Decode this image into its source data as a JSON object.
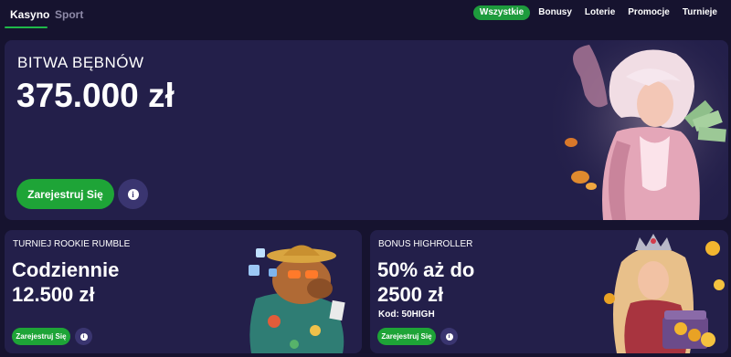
{
  "nav": {
    "tabs": [
      {
        "label": "Kasyno",
        "active": true
      },
      {
        "label": "Sport",
        "active": false
      }
    ],
    "filters": [
      {
        "label": "Wszystkie",
        "active": true
      },
      {
        "label": "Bonusy",
        "active": false
      },
      {
        "label": "Loterie",
        "active": false
      },
      {
        "label": "Promocje",
        "active": false
      },
      {
        "label": "Turnieje",
        "active": false
      }
    ]
  },
  "hero": {
    "eyebrow": "BITWA BĘBNÓW",
    "amount": "375.000 zł",
    "cta_label": "Zarejestruj Się",
    "info_icon": "info-icon",
    "art": "elf-prince-character-illustration"
  },
  "cards": [
    {
      "eyebrow": "TURNIEJ ROOKIE RUMBLE",
      "title_line1": "Codziennie",
      "title_line2": "12.500 zł",
      "cta_label": "Zarejestruj Się",
      "art": "capybara-with-dice-illustration"
    },
    {
      "eyebrow": "BONUS HIGHROLLER",
      "title_line1": "50% aż do",
      "title_line2": "2500 zł",
      "code": "Kod: 50HIGH",
      "cta_label": "Zarejestruj Się",
      "art": "queen-with-gold-coins-illustration"
    }
  ],
  "colors": {
    "background": "#16132f",
    "panel": "#231f4a",
    "accent_green": "#1ea437",
    "info_button": "#3a3570"
  }
}
